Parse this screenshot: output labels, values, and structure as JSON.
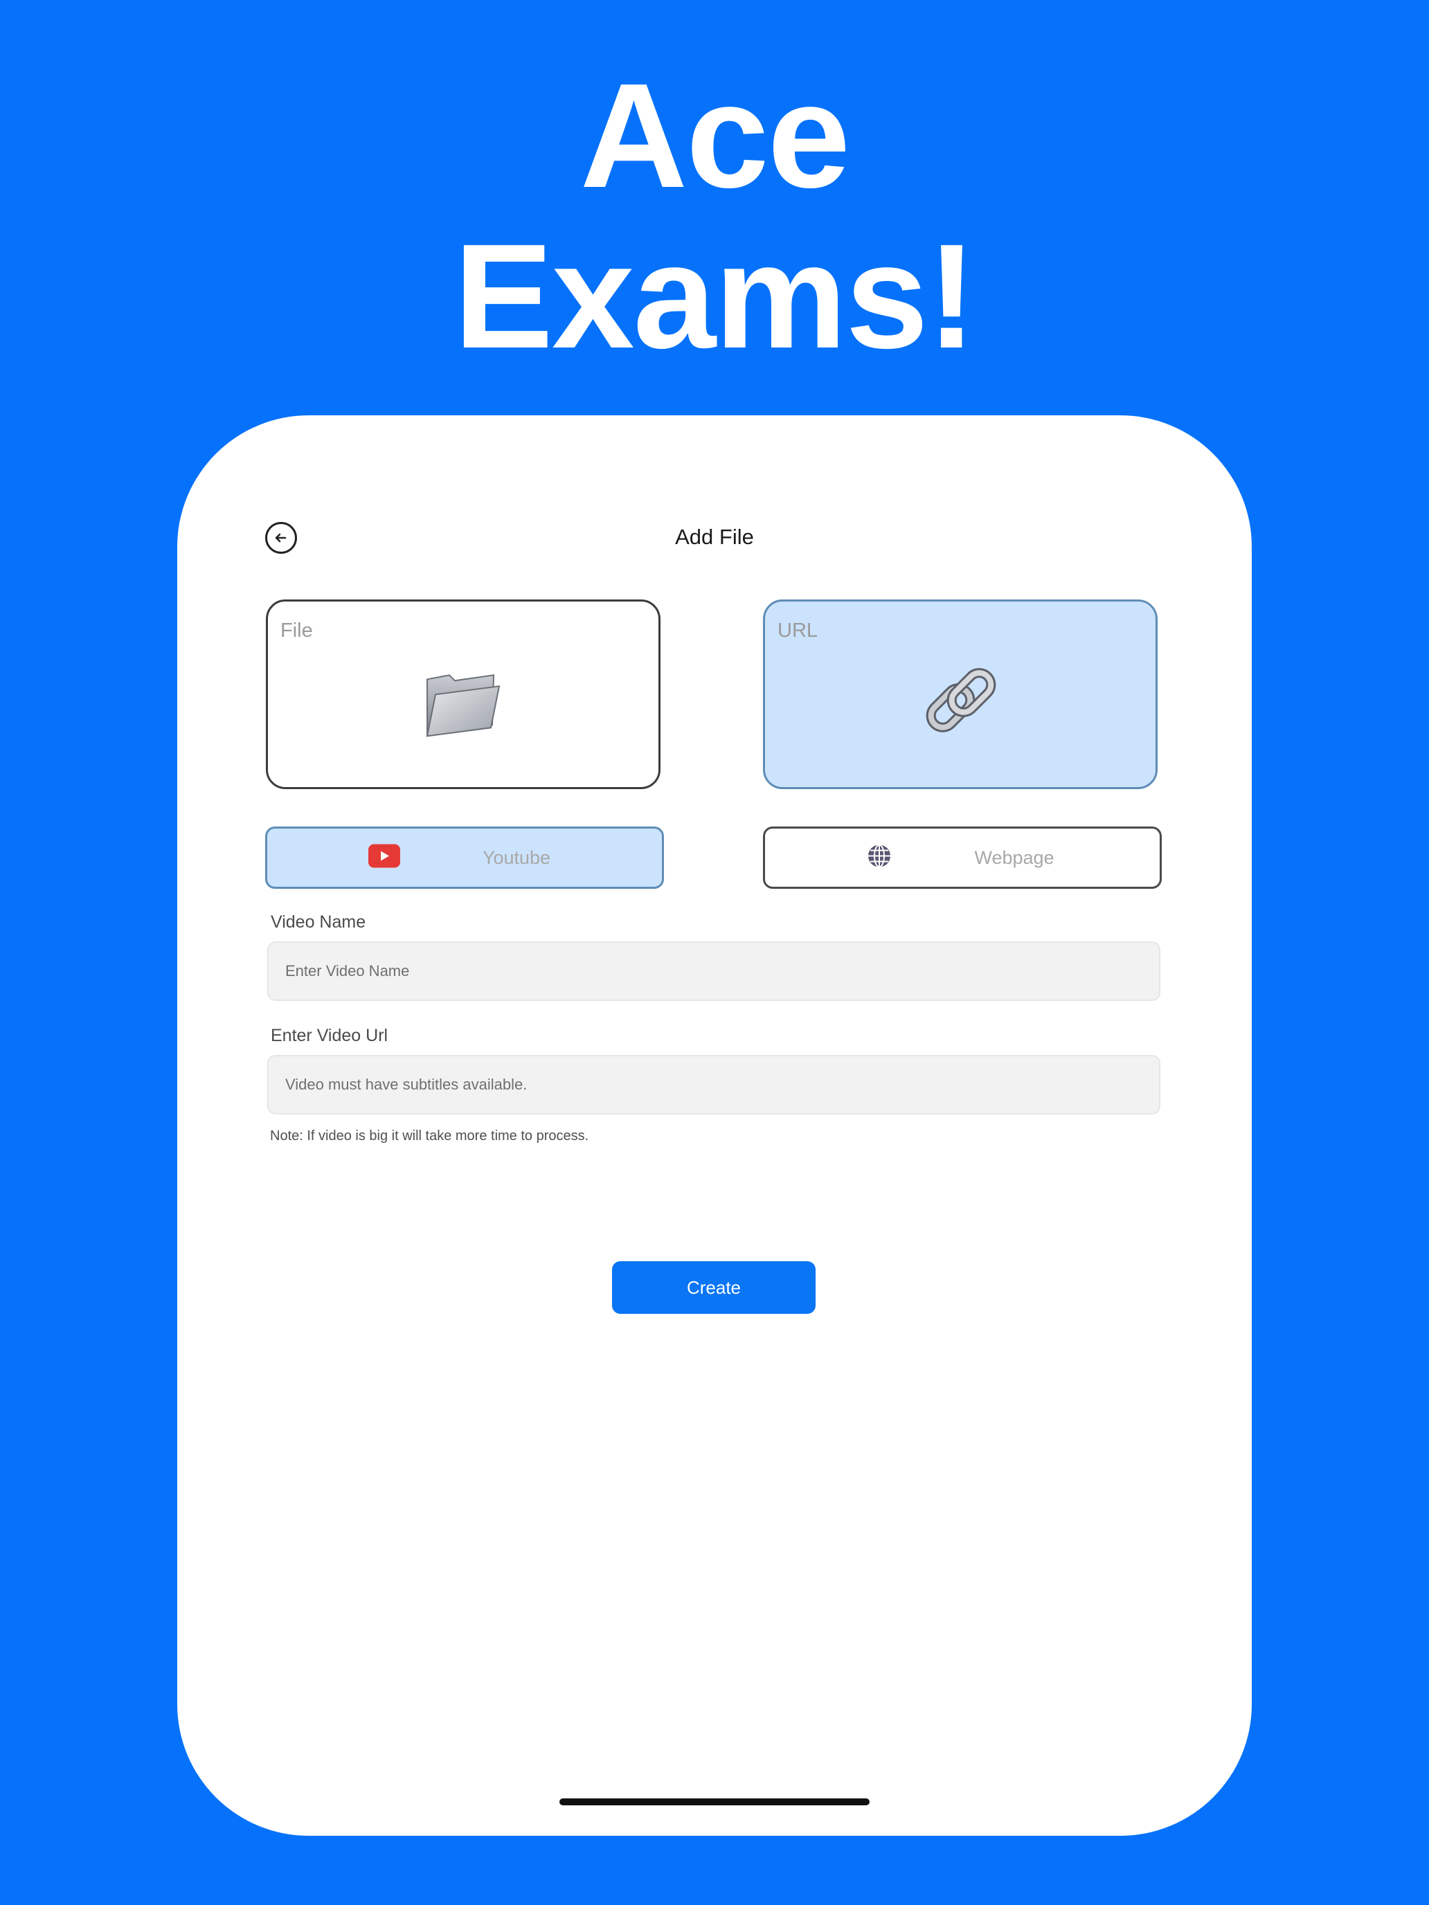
{
  "headline": {
    "line1": "Ace",
    "line2": "Exams!"
  },
  "header": {
    "title": "Add File",
    "back_icon": "arrow-left-circle-icon"
  },
  "source_cards": [
    {
      "label": "File",
      "icon": "folder-icon",
      "selected": false
    },
    {
      "label": "URL",
      "icon": "link-icon",
      "selected": true
    }
  ],
  "url_types": [
    {
      "label": "Youtube",
      "icon": "youtube-icon",
      "selected": true
    },
    {
      "label": "Webpage",
      "icon": "globe-icon",
      "selected": false
    }
  ],
  "form": {
    "video_name_label": "Video Name",
    "video_name_placeholder": "Enter Video Name",
    "video_url_label": "Enter Video Url",
    "video_url_placeholder": "Video must have subtitles available.",
    "note": "Note: If video is big it will take more time to process."
  },
  "actions": {
    "create_label": "Create"
  },
  "colors": {
    "background": "#0672FB",
    "selected_fill": "#CCE3FD",
    "primary_button": "#0A75F5",
    "youtube_red": "#E53935"
  }
}
